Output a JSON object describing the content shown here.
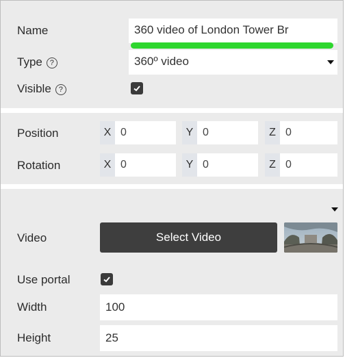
{
  "general": {
    "name_label": "Name",
    "name_value": "360 video of London Tower Br",
    "type_label": "Type",
    "type_value": "360º video",
    "visible_label": "Visible",
    "help_glyph": "?",
    "visible_checked": true
  },
  "transform": {
    "position_label": "Position",
    "rotation_label": "Rotation",
    "axes": [
      "X",
      "Y",
      "Z"
    ],
    "position": [
      "0",
      "0",
      "0"
    ],
    "rotation": [
      "0",
      "0",
      "0"
    ]
  },
  "video": {
    "video_label": "Video",
    "select_button_label": "Select Video",
    "use_portal_label": "Use portal",
    "use_portal_checked": true,
    "width_label": "Width",
    "width_value": "100",
    "height_label": "Height",
    "height_value": "25"
  },
  "colors": {
    "accent_progress": "#2ed62e",
    "panel_bg": "#ebebeb",
    "button_bg": "#3e3e3e"
  }
}
